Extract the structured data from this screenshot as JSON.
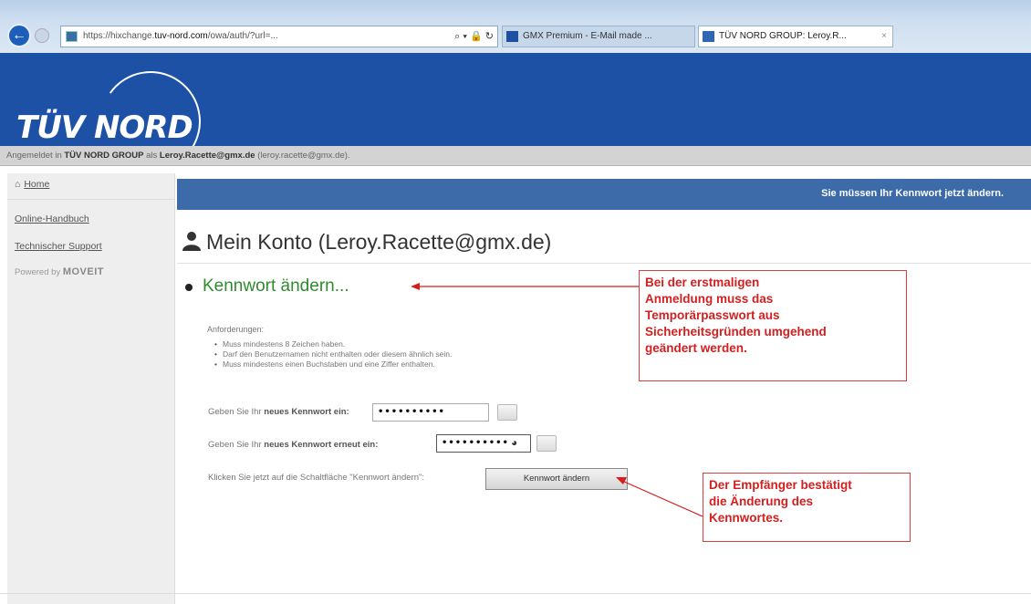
{
  "browser": {
    "address_prefix": "https://",
    "address_blur1": "hixchange.",
    "address_domain": "tuv-nord.com",
    "address_rest": "/owa/auth/?url=...",
    "tabs": [
      {
        "label": "GMX Premium - E-Mail made ..."
      },
      {
        "label": "TÜV NORD GROUP: Leroy.R...",
        "close": "×"
      }
    ]
  },
  "logo": "TÜV NORD",
  "login_bar": {
    "prefix": "Angemeldet in",
    "org": "TÜV NORD GROUP",
    "as": "als",
    "user": "Leroy.Racette@gmx.de",
    "paren": "(leroy.racette@gmx.de)."
  },
  "sidebar": {
    "items": [
      {
        "label": "Home",
        "icon": "home-icon"
      },
      {
        "label": "Online-Handbuch"
      },
      {
        "label": "Technischer Support"
      }
    ],
    "powered_prefix": "Powered by",
    "powered_brand": "MOVEIT"
  },
  "notice": "Sie müssen Ihr Kennwort jetzt ändern.",
  "page_title": "Mein Konto (Leroy.Racette@gmx.de)",
  "section_title": "Kennwort ändern...",
  "requirements": {
    "heading": "Anforderungen:",
    "items": [
      "Muss mindestens 8 Zeichen haben.",
      "Darf den Benutzernamen nicht enthalten oder diesem ähnlich sein.",
      "Muss mindestens einen Buchstaben und eine Ziffer enthalten."
    ]
  },
  "form": {
    "new_pw_label_pre": "Geben Sie Ihr",
    "new_pw_label_bold": "neues Kennwort ein:",
    "new_pw_value": "••••••••••",
    "repeat_pw_label_pre": "Geben Sie Ihr",
    "repeat_pw_label_bold": "neues Kennwort erneut ein:",
    "repeat_pw_value": "••••••••••",
    "click_label": "Klicken Sie jetzt auf die Schaltfläche \"Kennwort ändern\":",
    "submit_label": "Kennwort ändern"
  },
  "callouts": {
    "first": [
      "Bei der erstmaligen",
      "Anmeldung muss das",
      "Temporärpasswort aus",
      "Sicherheitsgründen umgehend",
      "geändert werden."
    ],
    "second": [
      "Der Empfänger bestätigt",
      "die Änderung des",
      "Kennwortes."
    ]
  },
  "colors": {
    "header_blue": "#1c51a6",
    "notice_blue": "#3d6aa9",
    "section_green": "#2e8b2e",
    "callout_red": "#d31f1f"
  }
}
